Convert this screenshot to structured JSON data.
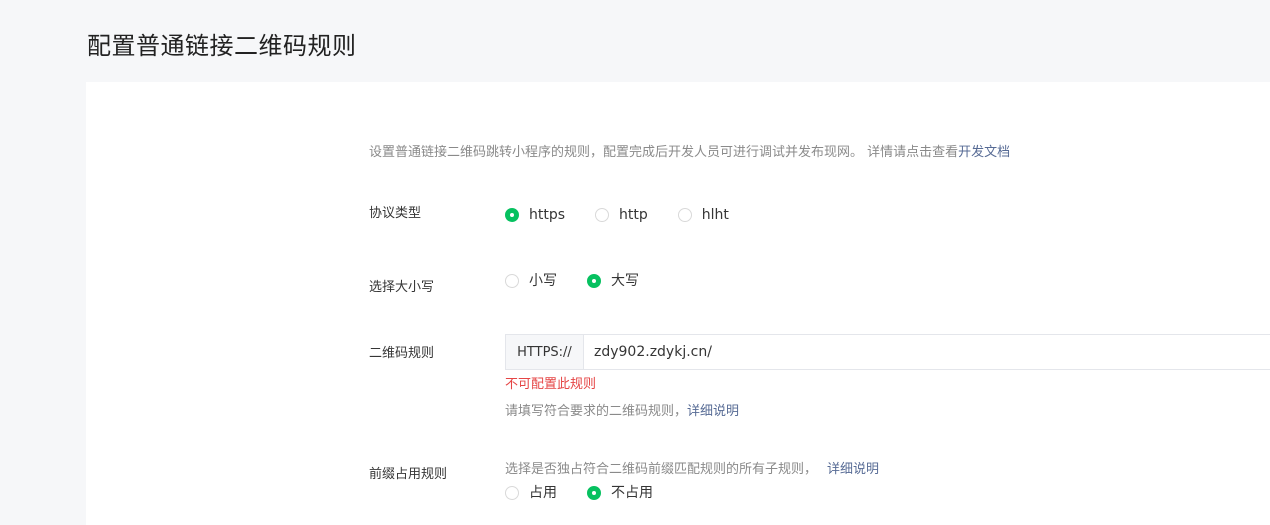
{
  "page": {
    "title": "配置普通链接二维码规则"
  },
  "description": {
    "text": "设置普通链接二维码跳转小程序的规则，配置完成后开发人员可进行调试并发布现网。 详情请点击查看",
    "link": "开发文档"
  },
  "protocol": {
    "label": "协议类型",
    "options": [
      {
        "label": "https",
        "checked": true
      },
      {
        "label": "http",
        "checked": false
      },
      {
        "label": "hlht",
        "checked": false
      }
    ]
  },
  "case": {
    "label": "选择大小写",
    "options": [
      {
        "label": "小写",
        "checked": false
      },
      {
        "label": "大写",
        "checked": true
      }
    ]
  },
  "qr_rule": {
    "label": "二维码规则",
    "prefix": "HTTPS://",
    "value": "zdy902.zdykj.cn/",
    "error": "不可配置此规则",
    "hint": "请填写符合要求的二维码规则，",
    "hint_link": "详细说明"
  },
  "prefix_rule": {
    "label": "前缀占用规则",
    "hint": "选择是否独占符合二维码前缀匹配规则的所有子规则，",
    "hint_link": "详细说明",
    "options": [
      {
        "label": "占用",
        "checked": false
      },
      {
        "label": "不占用",
        "checked": true
      }
    ]
  },
  "colors": {
    "accent": "#07c160",
    "link": "#576b95",
    "error": "#e54545"
  }
}
